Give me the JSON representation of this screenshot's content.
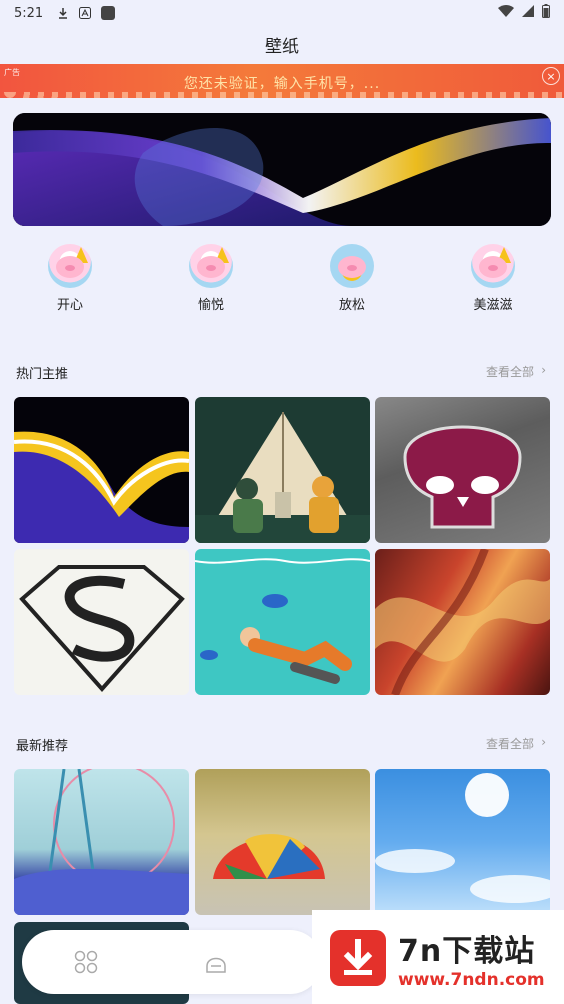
{
  "status_bar": {
    "time": "5:21"
  },
  "page_title": "壁纸",
  "ad": {
    "tag": "广告",
    "text": "您还未验证，输入手机号，...",
    "close": "×"
  },
  "moods": [
    {
      "label": "开心"
    },
    {
      "label": "愉悦"
    },
    {
      "label": "放松"
    },
    {
      "label": "美滋滋"
    }
  ],
  "hot": {
    "title": "热门主推",
    "more": "查看全部",
    "chevron": "›"
  },
  "latest": {
    "title": "最新推荐",
    "more": "查看全部",
    "chevron": "›"
  },
  "watermark": {
    "title": "7n下载站",
    "subtitle": "www.7ndn.com"
  },
  "colors": {
    "accent_red": "#e4312b",
    "background": "#eef0fc"
  }
}
